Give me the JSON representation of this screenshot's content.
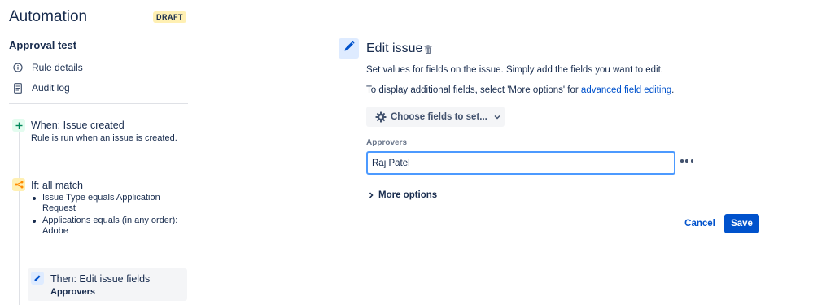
{
  "header": {
    "app_title": "Automation",
    "status_badge": "DRAFT"
  },
  "rule": {
    "name": "Approval test",
    "nav": [
      {
        "label": "Rule details",
        "icon": "info-icon"
      },
      {
        "label": "Audit log",
        "icon": "document-icon"
      }
    ]
  },
  "steps": {
    "trigger": {
      "title": "When: Issue created",
      "description": "Rule is run when an issue is created.",
      "icon": "plus-icon",
      "color": "#00875a",
      "bg": "#e3fcef"
    },
    "condition": {
      "title": "If: all match",
      "icon": "branch-icon",
      "color": "#ff8b00",
      "bg": "#fff0b3",
      "items": [
        "Issue Type equals Application Request",
        "Applications equals (in any order): Adobe"
      ]
    },
    "action": {
      "title": "Then: Edit issue fields",
      "subtitle": "Approvers",
      "icon": "pencil-icon",
      "color": "#0052cc",
      "bg": "#deebff"
    }
  },
  "editor": {
    "title": "Edit issue",
    "description_1": "Set values for fields on the issue. Simply add the fields you want to edit.",
    "description_2_prefix": "To display additional fields, select 'More options' for ",
    "description_2_link": "advanced field editing",
    "description_2_suffix": ".",
    "choose_fields_label": "Choose fields to set...",
    "field": {
      "label": "Approvers",
      "value": "Raj Patel"
    },
    "more_options_label": "More options",
    "cancel_label": "Cancel",
    "save_label": "Save"
  },
  "colors": {
    "primary": "#0052cc",
    "focus_border": "#4c9aff",
    "text": "#172b4d"
  }
}
